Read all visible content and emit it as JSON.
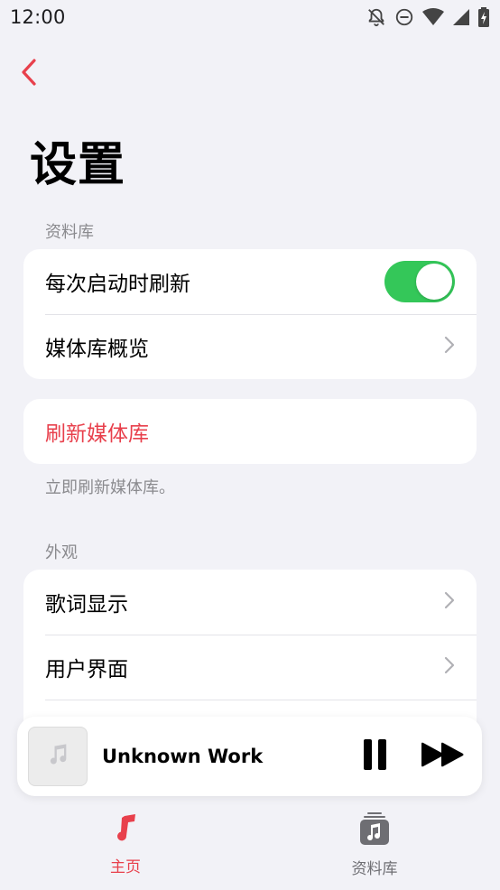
{
  "status_bar": {
    "time": "12:00"
  },
  "header": {
    "back_icon": "chevron-left-icon",
    "title": "设置"
  },
  "sections": {
    "library": {
      "header": "资料库",
      "items": [
        {
          "label": "每次启动时刷新",
          "control": "toggle",
          "toggle_on": true
        },
        {
          "label": "媒体库概览",
          "control": "chevron"
        }
      ]
    },
    "refresh": {
      "button_label": "刷新媒体库",
      "footnote": "立即刷新媒体库。"
    },
    "appearance": {
      "header": "外观",
      "items": [
        {
          "label": "歌词显示",
          "control": "chevron"
        },
        {
          "label": "用户界面",
          "control": "chevron"
        }
      ]
    }
  },
  "mini_player": {
    "track_title": "Unknown Work",
    "artwork_icon": "music-note-icon",
    "pause_icon": "pause-icon",
    "next_icon": "fast-forward-icon"
  },
  "tab_bar": {
    "tabs": [
      {
        "label": "主页",
        "icon": "music-note-icon",
        "active": true
      },
      {
        "label": "资料库",
        "icon": "library-icon",
        "active": false
      }
    ]
  },
  "colors": {
    "accent": "#e8404c",
    "toggle_on": "#34c759",
    "background": "#f2f2f7",
    "secondary_text": "#8a8a8e"
  }
}
